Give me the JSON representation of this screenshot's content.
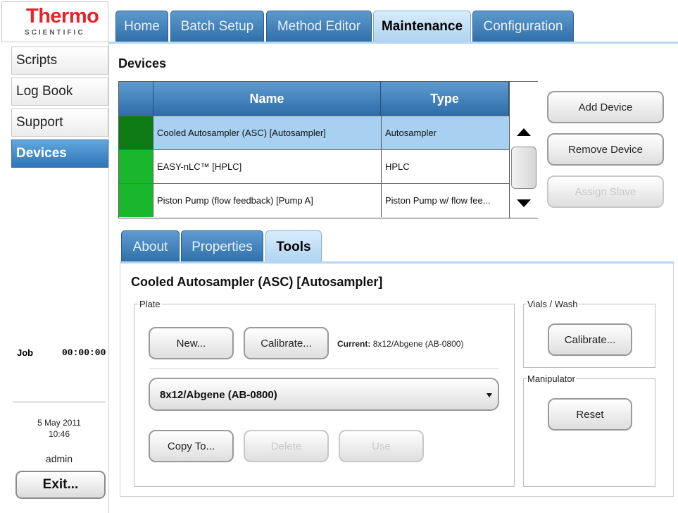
{
  "logo": {
    "main": "Thermo",
    "sub": "SCIENTIFIC"
  },
  "top_tabs": [
    "Home",
    "Batch Setup",
    "Method Editor",
    "Maintenance",
    "Configuration"
  ],
  "active_top_tab": "Maintenance",
  "sidebar": {
    "items": [
      "Scripts",
      "Log Book",
      "Support",
      "Devices"
    ],
    "active": "Devices",
    "job_label": "Job",
    "job_time": "00:00:00",
    "date": "5 May 2011",
    "time": "10:46",
    "user": "admin",
    "exit_label": "Exit..."
  },
  "main": {
    "heading": "Devices",
    "grid": {
      "columns": [
        "Name",
        "Type"
      ],
      "rows": [
        {
          "name": "Cooled Autosampler (ASC) [Autosampler]",
          "type": "Autosampler",
          "status_color": "#0d7a14",
          "selected": true
        },
        {
          "name": "EASY-nLC™ [HPLC]",
          "type": "HPLC",
          "status_color": "#19b82c",
          "selected": false
        },
        {
          "name": "Piston Pump (flow feedback) [Pump A]",
          "type": "Piston Pump w/ flow fee...",
          "status_color": "#19b82c",
          "selected": false
        }
      ]
    },
    "buttons": {
      "add": "Add Device",
      "remove": "Remove Device",
      "assign": "Assign Slave"
    },
    "tabs": [
      "About",
      "Properties",
      "Tools"
    ],
    "active_tab": "Tools",
    "tools": {
      "title": "Cooled Autosampler (ASC) [Autosampler]",
      "plate_legend": "Plate",
      "new_label": "New...",
      "calibrate_label": "Calibrate...",
      "current_label": "Current:",
      "current_value": "8x12/Abgene (AB-0800)",
      "plate_select_value": "8x12/Abgene (AB-0800)",
      "copy_label": "Copy To...",
      "delete_label": "Delete",
      "use_label": "Use",
      "vials_legend": "Vials / Wash",
      "vials_calibrate_label": "Calibrate...",
      "manipulator_legend": "Manipulator",
      "reset_label": "Reset"
    }
  },
  "colors": {
    "tab_blue": "#3a7ab5",
    "tab_active": "#c3e0f7",
    "selected_row": "#a8d1f1",
    "logo_red": "#e8232a"
  }
}
